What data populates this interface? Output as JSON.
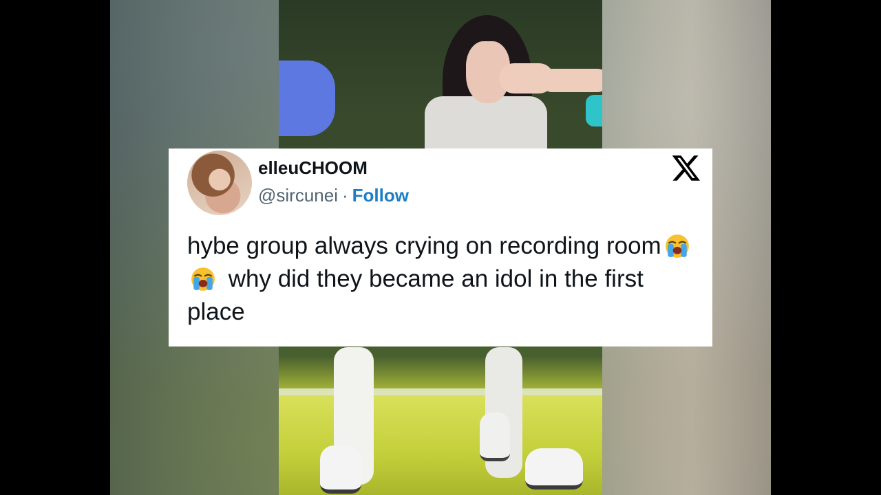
{
  "tweet": {
    "display_name": "elleuCHOOM",
    "handle": "@sircunei",
    "separator": "·",
    "follow_label": "Follow",
    "text_part1": "hybe group always crying on recording room",
    "emoji_name": "loudly-crying-face",
    "emoji_count": 2,
    "text_part2": " why did they became an idol in the first place"
  },
  "icons": {
    "platform_logo": "x-logo-icon"
  },
  "colors": {
    "follow": "#1d7ec6",
    "handle": "#536471",
    "text": "#0f1419",
    "card_bg": "#ffffff"
  }
}
